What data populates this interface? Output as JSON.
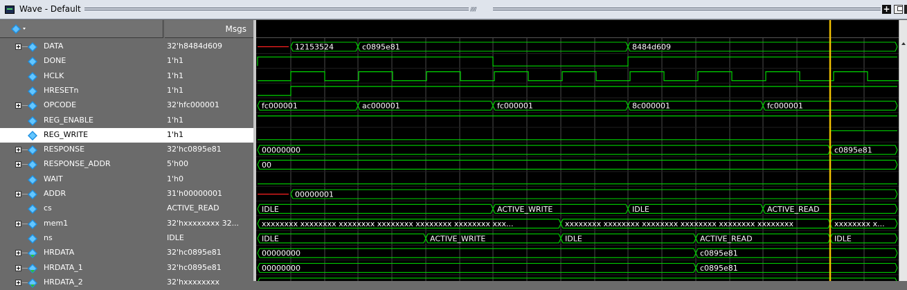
{
  "window": {
    "title": "Wave - Default",
    "grip": "/////"
  },
  "panel": {
    "msgs_header": "Msgs"
  },
  "signals": [
    {
      "name": "DATA",
      "value": "32'h8484d609",
      "expandable": true,
      "icon": "bus-signal-icon"
    },
    {
      "name": "DONE",
      "value": "1'h1",
      "expandable": false,
      "icon": "bit-signal-icon"
    },
    {
      "name": "HCLK",
      "value": "1'h1",
      "expandable": false,
      "icon": "bit-signal-icon"
    },
    {
      "name": "HRESETn",
      "value": "1'h1",
      "expandable": false,
      "icon": "bit-signal-icon"
    },
    {
      "name": "OPCODE",
      "value": "32'hfc000001",
      "expandable": true,
      "icon": "bus-signal-icon"
    },
    {
      "name": "REG_ENABLE",
      "value": "1'h1",
      "expandable": false,
      "icon": "bit-signal-icon"
    },
    {
      "name": "REG_WRITE",
      "value": "1'h1",
      "expandable": false,
      "icon": "bit-signal-icon",
      "selected": true
    },
    {
      "name": "RESPONSE",
      "value": "32'hc0895e81",
      "expandable": true,
      "icon": "bus-signal-icon"
    },
    {
      "name": "RESPONSE_ADDR",
      "value": "5'h00",
      "expandable": true,
      "icon": "bus-signal-icon"
    },
    {
      "name": "WAIT",
      "value": "1'h0",
      "expandable": false,
      "icon": "bit-signal-icon"
    },
    {
      "name": "ADDR",
      "value": "31'h00000001",
      "expandable": true,
      "icon": "bus-signal-icon"
    },
    {
      "name": "cs",
      "value": "ACTIVE_READ",
      "expandable": false,
      "icon": "bit-signal-icon"
    },
    {
      "name": "mem1",
      "value": "32'hxxxxxxxx 32...",
      "expandable": true,
      "icon": "bus-signal-icon"
    },
    {
      "name": "ns",
      "value": "IDLE",
      "expandable": false,
      "icon": "bit-signal-icon"
    },
    {
      "name": "HRDATA",
      "value": "32'hc0895e81",
      "expandable": true,
      "icon": "input-bus-signal-icon"
    },
    {
      "name": "HRDATA_1",
      "value": "32'hc0895e81",
      "expandable": true,
      "icon": "input-bus-signal-icon"
    },
    {
      "name": "HRDATA_2",
      "value": "32'hxxxxxxxx",
      "expandable": true,
      "icon": "input-bus-signal-icon"
    }
  ],
  "waves": [
    {
      "type": "bus",
      "undefined_until": 48,
      "segments": [
        {
          "t": 48,
          "label": "12153524"
        },
        {
          "t": 145,
          "label": "c0895e81"
        },
        {
          "t": 535,
          "label": "8484d609"
        }
      ]
    },
    {
      "type": "bit",
      "edges": [
        [
          0,
          0
        ],
        [
          0,
          1
        ],
        [
          340,
          1
        ],
        [
          340,
          0
        ],
        [
          535,
          0
        ],
        [
          535,
          1
        ]
      ]
    },
    {
      "type": "clock",
      "start": 48,
      "half": 49
    },
    {
      "type": "bit",
      "edges": [
        [
          0,
          0
        ],
        [
          48,
          0
        ],
        [
          48,
          1
        ]
      ]
    },
    {
      "type": "bus",
      "segments": [
        {
          "t": 0,
          "label": "fc000001"
        },
        {
          "t": 145,
          "label": "ac000001"
        },
        {
          "t": 340,
          "label": "fc000001"
        },
        {
          "t": 535,
          "label": "8c000001"
        },
        {
          "t": 730,
          "label": "fc000001"
        }
      ]
    },
    {
      "type": "bit",
      "edges": [
        [
          0,
          1
        ]
      ]
    },
    {
      "type": "bit",
      "edges": [
        [
          0,
          0
        ],
        [
          827,
          0
        ],
        [
          827,
          1
        ]
      ]
    },
    {
      "type": "bus",
      "segments": [
        {
          "t": 0,
          "label": "00000000"
        },
        {
          "t": 827,
          "label": "c0895e81"
        }
      ]
    },
    {
      "type": "bus",
      "segments": [
        {
          "t": 0,
          "label": "00"
        }
      ]
    },
    {
      "type": "bit",
      "edges": [
        [
          0,
          0
        ]
      ]
    },
    {
      "type": "bus",
      "undefined_until": 48,
      "segments": [
        {
          "t": 48,
          "label": "00000001"
        }
      ]
    },
    {
      "type": "bus",
      "segments": [
        {
          "t": 0,
          "label": "IDLE"
        },
        {
          "t": 340,
          "label": "ACTIVE_WRITE"
        },
        {
          "t": 535,
          "label": "IDLE"
        },
        {
          "t": 730,
          "label": "ACTIVE_READ"
        }
      ]
    },
    {
      "type": "bus",
      "segments": [
        {
          "t": 0,
          "label": "xxxxxxxx xxxxxxxx xxxxxxxx xxxxxxxx xxxxxxxx xxxxxxxx xxx..."
        },
        {
          "t": 438,
          "label": "xxxxxxxx xxxxxxxx xxxxxxxx xxxxxxxx xxxxxxxx xxxxxxxx"
        },
        {
          "t": 827,
          "label": "xxxxxxxx x..."
        }
      ]
    },
    {
      "type": "bus",
      "segments": [
        {
          "t": 0,
          "label": "IDLE"
        },
        {
          "t": 243,
          "label": "ACTIVE_WRITE"
        },
        {
          "t": 438,
          "label": "IDLE"
        },
        {
          "t": 633,
          "label": "ACTIVE_READ"
        },
        {
          "t": 827,
          "label": "IDLE"
        }
      ]
    },
    {
      "type": "bus",
      "segments": [
        {
          "t": 0,
          "label": "00000000"
        },
        {
          "t": 633,
          "label": "c0895e81"
        }
      ]
    },
    {
      "type": "bus",
      "segments": [
        {
          "t": 0,
          "label": "00000000"
        },
        {
          "t": 633,
          "label": "c0895e81"
        }
      ]
    },
    {
      "type": "bus",
      "segments": [
        {
          "t": 0,
          "label": ""
        }
      ]
    }
  ],
  "cursor": {
    "t": 827
  },
  "colors": {
    "wave": "#00d600",
    "undefined": "#ff2020",
    "cursor": "#f0c000",
    "grid": "#4a4a4a",
    "label": "#ffffff"
  }
}
